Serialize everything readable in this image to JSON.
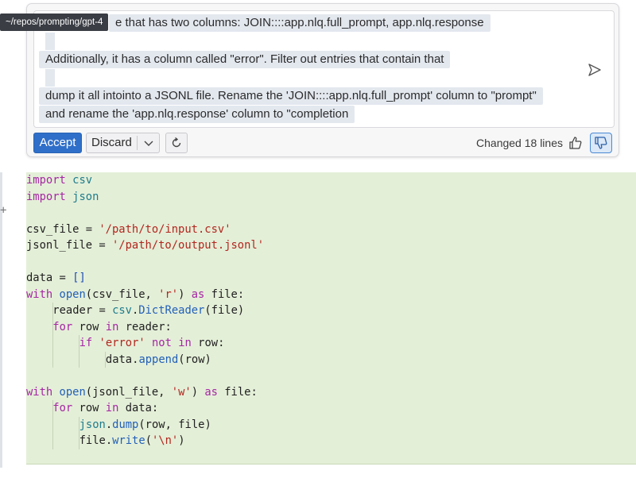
{
  "tooltip": {
    "path": "~/repos/prompting/gpt-4"
  },
  "prompt": {
    "line1": "e that has two columns: JOIN::::app.nlq.full_prompt, app.nlq.response",
    "line2": "Additionally, it has a column called \"error\". Filter out entries that contain that",
    "line3": "dump it all intointo a JSONL file. Rename the 'JOIN::::app.nlq.full_prompt' column to \"prompt\"",
    "line4": "and rename the 'app.nlq.response' column to \"completion"
  },
  "toolbar": {
    "accept_label": "Accept",
    "discard_label": "Discard",
    "changed_text": "Changed 18 lines"
  },
  "editor": {
    "expand_glyph": "+"
  },
  "colors": {
    "accent": "#2f6fc9",
    "diff_added_bg": "#e4efd8",
    "keyword": "#a626a4",
    "string": "#b3261e",
    "function": "#2260b8"
  },
  "code": [
    {
      "indent": 0,
      "tokens": [
        {
          "t": "import",
          "c": "kw"
        },
        {
          "t": " "
        },
        {
          "t": "csv",
          "c": "mod"
        }
      ]
    },
    {
      "indent": 0,
      "tokens": [
        {
          "t": "import",
          "c": "kw"
        },
        {
          "t": " "
        },
        {
          "t": "json",
          "c": "mod"
        }
      ]
    },
    {
      "indent": 0,
      "tokens": []
    },
    {
      "indent": 0,
      "tokens": [
        {
          "t": "csv_file = "
        },
        {
          "t": "'/path/to/input.csv'",
          "c": "str"
        }
      ]
    },
    {
      "indent": 0,
      "tokens": [
        {
          "t": "jsonl_file = "
        },
        {
          "t": "'/path/to/output.jsonl'",
          "c": "str"
        }
      ]
    },
    {
      "indent": 0,
      "tokens": []
    },
    {
      "indent": 0,
      "tokens": [
        {
          "t": "data = "
        },
        {
          "t": "[]",
          "c": "br"
        }
      ]
    },
    {
      "indent": 0,
      "tokens": [
        {
          "t": "with",
          "c": "kw"
        },
        {
          "t": " "
        },
        {
          "t": "open",
          "c": "fn"
        },
        {
          "t": "(csv_file, "
        },
        {
          "t": "'r'",
          "c": "str"
        },
        {
          "t": ") "
        },
        {
          "t": "as",
          "c": "kw"
        },
        {
          "t": " file:"
        }
      ]
    },
    {
      "indent": 1,
      "tokens": [
        {
          "t": "reader = "
        },
        {
          "t": "csv",
          "c": "mod"
        },
        {
          "t": "."
        },
        {
          "t": "DictReader",
          "c": "fn"
        },
        {
          "t": "(file)"
        }
      ]
    },
    {
      "indent": 1,
      "tokens": [
        {
          "t": "for",
          "c": "kw"
        },
        {
          "t": " row "
        },
        {
          "t": "in",
          "c": "kw"
        },
        {
          "t": " reader:"
        }
      ]
    },
    {
      "indent": 2,
      "tokens": [
        {
          "t": "if",
          "c": "kw"
        },
        {
          "t": " "
        },
        {
          "t": "'error'",
          "c": "str"
        },
        {
          "t": " "
        },
        {
          "t": "not",
          "c": "kw"
        },
        {
          "t": " "
        },
        {
          "t": "in",
          "c": "kw"
        },
        {
          "t": " row:"
        }
      ]
    },
    {
      "indent": 3,
      "tokens": [
        {
          "t": "data."
        },
        {
          "t": "append",
          "c": "fn"
        },
        {
          "t": "(row)"
        }
      ]
    },
    {
      "indent": 0,
      "tokens": []
    },
    {
      "indent": 0,
      "tokens": [
        {
          "t": "with",
          "c": "kw"
        },
        {
          "t": " "
        },
        {
          "t": "open",
          "c": "fn"
        },
        {
          "t": "(jsonl_file, "
        },
        {
          "t": "'w'",
          "c": "str"
        },
        {
          "t": ") "
        },
        {
          "t": "as",
          "c": "kw"
        },
        {
          "t": " file:"
        }
      ]
    },
    {
      "indent": 1,
      "tokens": [
        {
          "t": "for",
          "c": "kw"
        },
        {
          "t": " row "
        },
        {
          "t": "in",
          "c": "kw"
        },
        {
          "t": " data:"
        }
      ]
    },
    {
      "indent": 2,
      "tokens": [
        {
          "t": "json",
          "c": "mod"
        },
        {
          "t": "."
        },
        {
          "t": "dump",
          "c": "fn"
        },
        {
          "t": "(row, file)"
        }
      ]
    },
    {
      "indent": 2,
      "tokens": [
        {
          "t": "file."
        },
        {
          "t": "write",
          "c": "fn"
        },
        {
          "t": "("
        },
        {
          "t": "'\\n'",
          "c": "str"
        },
        {
          "t": ")"
        }
      ]
    }
  ]
}
